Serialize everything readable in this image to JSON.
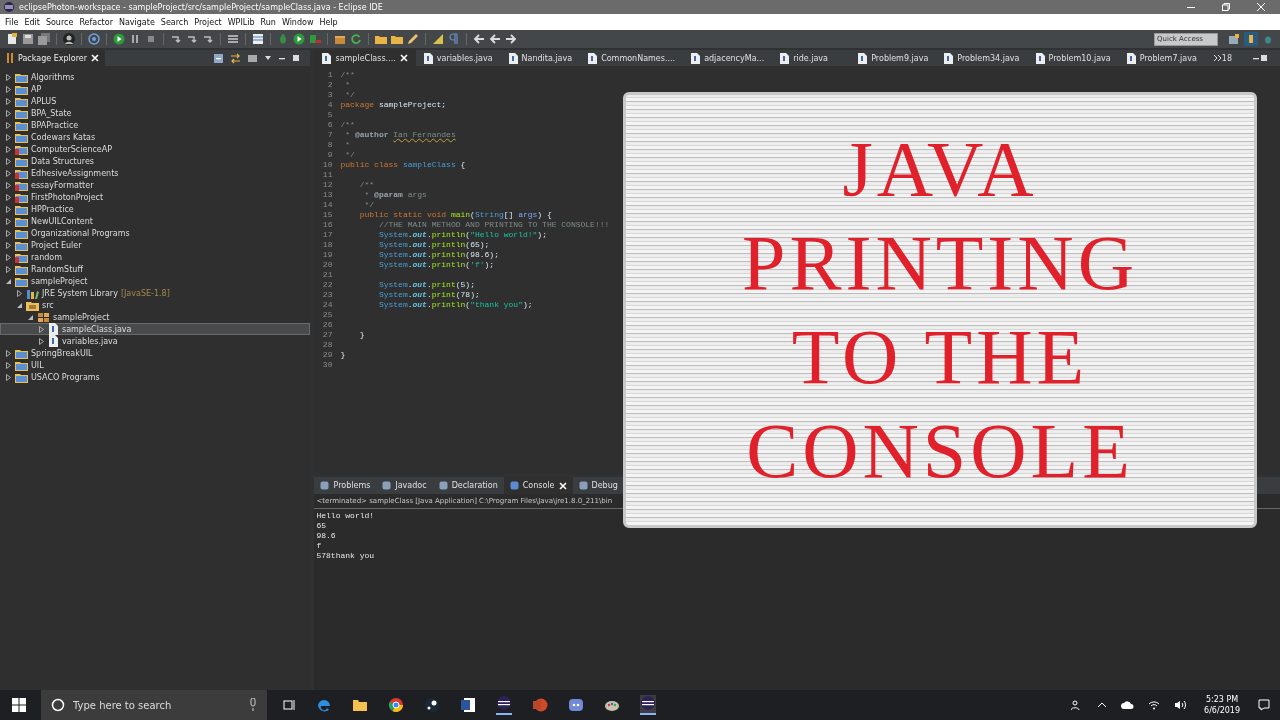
{
  "window": {
    "title": "eclipsePhoton-workspace - sampleProject/src/sampleProject/sampleClass.java - Eclipse IDE"
  },
  "menu": [
    "File",
    "Edit",
    "Source",
    "Refactor",
    "Navigate",
    "Search",
    "Project",
    "WPILib",
    "Run",
    "Window",
    "Help"
  ],
  "quick_access": {
    "placeholder": "Quick Access"
  },
  "package_explorer": {
    "title": "Package Explorer",
    "items": [
      {
        "label": "Algorithms",
        "kind": "project",
        "expanded": false,
        "selected": false
      },
      {
        "label": "AP",
        "kind": "project",
        "expanded": false,
        "selected": false
      },
      {
        "label": "APLUS",
        "kind": "project",
        "expanded": false,
        "selected": false
      },
      {
        "label": "BPA_State",
        "kind": "project",
        "expanded": false,
        "selected": false
      },
      {
        "label": "BPAPractice",
        "kind": "project",
        "expanded": false,
        "selected": false
      },
      {
        "label": "Codewars Katas",
        "kind": "project",
        "expanded": false,
        "selected": false
      },
      {
        "label": "ComputerScienceAP",
        "kind": "project_error",
        "expanded": false,
        "selected": false
      },
      {
        "label": "Data Structures",
        "kind": "project",
        "expanded": false,
        "selected": false
      },
      {
        "label": "EdhesiveAssignments",
        "kind": "project_error",
        "expanded": false,
        "selected": false
      },
      {
        "label": "essayFormatter",
        "kind": "project_error",
        "expanded": false,
        "selected": false
      },
      {
        "label": "FirstPhotonProject",
        "kind": "project_error",
        "expanded": false,
        "selected": false
      },
      {
        "label": "HPPractice",
        "kind": "project",
        "expanded": false,
        "selected": false
      },
      {
        "label": "NewUILContent",
        "kind": "project",
        "expanded": false,
        "selected": false
      },
      {
        "label": "Organizational Programs",
        "kind": "project",
        "expanded": false,
        "selected": false
      },
      {
        "label": "Project Euler",
        "kind": "project",
        "expanded": false,
        "selected": false
      },
      {
        "label": "random",
        "kind": "project_error",
        "expanded": false,
        "selected": false
      },
      {
        "label": "RandomStuff",
        "kind": "project",
        "expanded": false,
        "selected": false
      },
      {
        "label": "sampleProject",
        "kind": "project",
        "expanded": true,
        "selected": false,
        "children": [
          {
            "label": "JRE System Library",
            "decoration": "[JavaSE-1.8]",
            "kind": "library",
            "expanded": false,
            "selected": false
          },
          {
            "label": "src",
            "kind": "folder",
            "expanded": true,
            "selected": false,
            "children": [
              {
                "label": "sampleProject",
                "kind": "package",
                "expanded": true,
                "selected": false,
                "children": [
                  {
                    "label": "sampleClass.java",
                    "kind": "file",
                    "expanded": false,
                    "selected": true
                  },
                  {
                    "label": "variables.java",
                    "kind": "file",
                    "expanded": false,
                    "selected": false
                  }
                ]
              }
            ]
          }
        ]
      },
      {
        "label": "SpringBreakUIL",
        "kind": "project",
        "expanded": false,
        "selected": false
      },
      {
        "label": "UIL",
        "kind": "project",
        "expanded": false,
        "selected": false
      },
      {
        "label": "USACO Programs",
        "kind": "project",
        "expanded": false,
        "selected": false
      }
    ]
  },
  "editor_tabs": [
    {
      "label": "sampleClass....",
      "selected": true
    },
    {
      "label": "variables.java",
      "selected": false
    },
    {
      "label": "Nandita.java",
      "selected": false
    },
    {
      "label": "CommonNames....",
      "selected": false
    },
    {
      "label": "adjacencyMa...",
      "selected": false
    },
    {
      "label": "ride.java",
      "selected": false
    },
    {
      "label": "Problem9.java",
      "selected": false
    },
    {
      "label": "Problem34.java",
      "selected": false
    },
    {
      "label": "Problem10.java",
      "selected": false
    },
    {
      "label": "Problem7.java",
      "selected": false
    }
  ],
  "hidden_tab_count": "18",
  "code": [
    {
      "number": "1",
      "tokens": [
        {
          "kind": "cm",
          "text": "/**"
        }
      ]
    },
    {
      "number": "2",
      "tokens": [
        {
          "kind": "cm",
          "text": " *"
        }
      ]
    },
    {
      "number": "3",
      "tokens": [
        {
          "kind": "cm",
          "text": " */"
        }
      ]
    },
    {
      "number": "4",
      "tokens": [
        {
          "kind": "kw",
          "text": "package"
        },
        {
          "kind": "pl",
          "text": " sampleProject;"
        }
      ]
    },
    {
      "number": "5"
    },
    {
      "number": "6",
      "tokens": [
        {
          "kind": "cm",
          "text": "/**"
        }
      ]
    },
    {
      "number": "7",
      "tokens": [
        {
          "kind": "cm",
          "text": " * "
        },
        {
          "kind": "tag",
          "text": "@author "
        },
        {
          "kind": "misspelled",
          "text": "Ian Fernandes"
        }
      ]
    },
    {
      "number": "8",
      "tokens": [
        {
          "kind": "cm",
          "text": " *"
        }
      ]
    },
    {
      "number": "9",
      "tokens": [
        {
          "kind": "cm",
          "text": " */"
        }
      ]
    },
    {
      "number": "10",
      "tokens": [
        {
          "kind": "kw",
          "text": "public class"
        },
        {
          "kind": "cls",
          "text": " sampleClass"
        },
        {
          "kind": "pl",
          "text": " {"
        }
      ]
    },
    {
      "number": "11"
    },
    {
      "number": "12",
      "tokens": [
        {
          "kind": "cm",
          "text": "    /**"
        }
      ]
    },
    {
      "number": "13",
      "tokens": [
        {
          "kind": "cm",
          "text": "     * "
        },
        {
          "kind": "tag",
          "text": "@param"
        },
        {
          "kind": "cm",
          "text": " args"
        }
      ]
    },
    {
      "number": "14",
      "tokens": [
        {
          "kind": "cm",
          "text": "     */"
        }
      ]
    },
    {
      "number": "15",
      "tokens": [
        {
          "kind": "kw",
          "text": "    public static void"
        },
        {
          "kind": "mth",
          "text": " main"
        },
        {
          "kind": "pl",
          "text": "("
        },
        {
          "kind": "cls",
          "text": "String"
        },
        {
          "kind": "pl",
          "text": "[] "
        },
        {
          "kind": "var",
          "text": "args"
        },
        {
          "kind": "pl",
          "text": ") {"
        }
      ]
    },
    {
      "number": "16",
      "tokens": [
        {
          "kind": "cm",
          "text": "        //THE MAIN METHOD AND PRINTING TO THE CONSOLE!!!"
        }
      ]
    },
    {
      "number": "17",
      "tokens": [
        {
          "kind": "cls",
          "text": "        System"
        },
        {
          "kind": "pl",
          "text": "."
        },
        {
          "kind": "fld",
          "text": "out"
        },
        {
          "kind": "pl",
          "text": "."
        },
        {
          "kind": "mth",
          "text": "println"
        },
        {
          "kind": "pl",
          "text": "("
        },
        {
          "kind": "str",
          "text": "\"Hello world!\""
        },
        {
          "kind": "pl",
          "text": ");"
        }
      ]
    },
    {
      "number": "18",
      "tokens": [
        {
          "kind": "cls",
          "text": "        System"
        },
        {
          "kind": "pl",
          "text": "."
        },
        {
          "kind": "fld",
          "text": "out"
        },
        {
          "kind": "pl",
          "text": "."
        },
        {
          "kind": "mth",
          "text": "println"
        },
        {
          "kind": "pl",
          "text": "(65);"
        }
      ]
    },
    {
      "number": "19",
      "tokens": [
        {
          "kind": "cls",
          "text": "        System"
        },
        {
          "kind": "pl",
          "text": "."
        },
        {
          "kind": "fld",
          "text": "out"
        },
        {
          "kind": "pl",
          "text": "."
        },
        {
          "kind": "mth",
          "text": "println"
        },
        {
          "kind": "pl",
          "text": "(98.6);"
        }
      ]
    },
    {
      "number": "20",
      "tokens": [
        {
          "kind": "cls",
          "text": "        System"
        },
        {
          "kind": "pl",
          "text": "."
        },
        {
          "kind": "fld",
          "text": "out"
        },
        {
          "kind": "pl",
          "text": "."
        },
        {
          "kind": "mth",
          "text": "println"
        },
        {
          "kind": "pl",
          "text": "("
        },
        {
          "kind": "str",
          "text": "'f'"
        },
        {
          "kind": "pl",
          "text": ");"
        }
      ]
    },
    {
      "number": "21"
    },
    {
      "number": "22",
      "tokens": [
        {
          "kind": "cls",
          "text": "        System"
        },
        {
          "kind": "pl",
          "text": "."
        },
        {
          "kind": "fld",
          "text": "out"
        },
        {
          "kind": "pl",
          "text": "."
        },
        {
          "kind": "mth",
          "text": "print"
        },
        {
          "kind": "pl",
          "text": "(5);"
        }
      ]
    },
    {
      "number": "23",
      "tokens": [
        {
          "kind": "cls",
          "text": "        System"
        },
        {
          "kind": "pl",
          "text": "."
        },
        {
          "kind": "fld",
          "text": "out"
        },
        {
          "kind": "pl",
          "text": "."
        },
        {
          "kind": "mth",
          "text": "print"
        },
        {
          "kind": "pl",
          "text": "(78);"
        }
      ]
    },
    {
      "number": "24",
      "tokens": [
        {
          "kind": "cls",
          "text": "        System"
        },
        {
          "kind": "pl",
          "text": "."
        },
        {
          "kind": "fld",
          "text": "out"
        },
        {
          "kind": "pl",
          "text": "."
        },
        {
          "kind": "mth",
          "text": "println"
        },
        {
          "kind": "pl",
          "text": "("
        },
        {
          "kind": "str",
          "text": "\"thank you\""
        },
        {
          "kind": "pl",
          "text": ");"
        }
      ]
    },
    {
      "number": "25"
    },
    {
      "number": "26"
    },
    {
      "number": "27",
      "tokens": [
        {
          "kind": "pl",
          "text": "    }"
        }
      ]
    },
    {
      "number": "28"
    },
    {
      "number": "29",
      "tokens": [
        {
          "kind": "pl",
          "text": "}"
        }
      ]
    },
    {
      "number": "30"
    }
  ],
  "bottom_tabs": [
    {
      "label": "Problems",
      "selected": false
    },
    {
      "label": "Javadoc",
      "selected": false
    },
    {
      "label": "Declaration",
      "selected": false
    },
    {
      "label": "Console",
      "selected": true
    },
    {
      "label": "Debug",
      "selected": false
    }
  ],
  "console": {
    "header": "<terminated> sampleClass [Java Application] C:\\Program Files\\Java\\jre1.8.0_211\\bin",
    "lines": [
      "Hello world!",
      "65",
      "98.6",
      "f",
      "578thank you"
    ]
  },
  "title_card": {
    "lines": [
      "JAVA",
      "PRINTING",
      "TO THE",
      "CONSOLE"
    ]
  },
  "taskbar": {
    "search_placeholder": "Type here to search",
    "time": "5:23 PM",
    "date": "6/6/2019"
  }
}
